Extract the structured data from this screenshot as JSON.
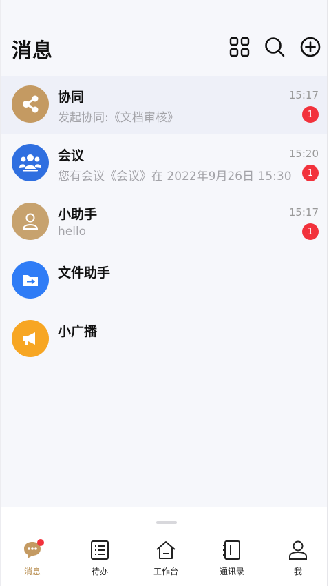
{
  "header": {
    "title": "消息",
    "icons": [
      "grid-icon",
      "search-icon",
      "add-circle-icon"
    ]
  },
  "conversations": [
    {
      "name": "协同",
      "time": "15:17",
      "preview": "发起协同:《文档审核》",
      "badge": "1",
      "icon": "share-icon",
      "color": "#c49a62"
    },
    {
      "name": "会议",
      "time": "15:20",
      "preview": "您有会议《会议》在 2022年9月26日 15:30",
      "badge": "1",
      "icon": "people-icon",
      "color": "#2f6fe0"
    },
    {
      "name": "小助手",
      "time": "15:17",
      "preview": "hello",
      "badge": "1",
      "icon": "person-icon",
      "color": "#c7a26e"
    },
    {
      "name": "文件助手",
      "time": "",
      "preview": "",
      "badge": "",
      "icon": "folder-icon",
      "color": "#2f7cf6"
    },
    {
      "name": "小广播",
      "time": "",
      "preview": "",
      "badge": "",
      "icon": "megaphone-icon",
      "color": "#f7a623"
    }
  ],
  "tabs": [
    {
      "label": "消息",
      "icon": "chat-icon",
      "active": true
    },
    {
      "label": "待办",
      "icon": "list-icon",
      "active": false
    },
    {
      "label": "工作台",
      "icon": "home-icon",
      "active": false
    },
    {
      "label": "通讯录",
      "icon": "contacts-icon",
      "active": false
    },
    {
      "label": "我",
      "icon": "user-icon",
      "active": false
    }
  ],
  "colors": {
    "accent": "#b88d4f",
    "badge": "#f2323c",
    "background": "#f6f7fb"
  }
}
